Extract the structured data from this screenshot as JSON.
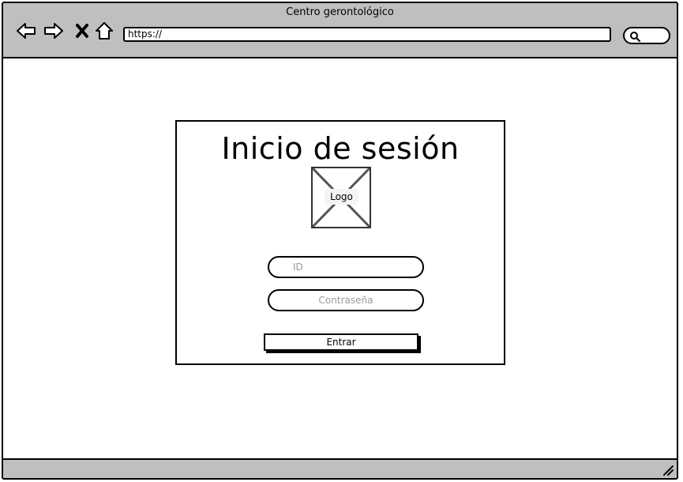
{
  "window": {
    "title": "Centro gerontológico"
  },
  "browser": {
    "url": "https://"
  },
  "login": {
    "title": "Inicio de sesión",
    "logo_label": "Logo",
    "id_placeholder": "ID",
    "password_placeholder": "Contraseña",
    "enter_label": "Entrar"
  },
  "colors": {
    "chrome": "#bfbfbf",
    "placeholder": "#9a9a9a"
  }
}
